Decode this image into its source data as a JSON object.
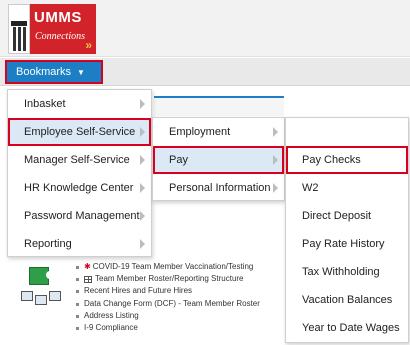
{
  "logo": {
    "title": "UMMS",
    "subtitle": "Connections",
    "chevron": "»"
  },
  "navbar": {
    "bookmarks_label": "Bookmarks",
    "caret": "▼"
  },
  "menu_level1": [
    {
      "label": "Inbasket"
    },
    {
      "label": "Employee Self-Service"
    },
    {
      "label": "Manager Self-Service"
    },
    {
      "label": "HR Knowledge Center"
    },
    {
      "label": "Password Management"
    },
    {
      "label": "Reporting"
    }
  ],
  "menu_level2": [
    {
      "label": "Employment"
    },
    {
      "label": "Pay"
    },
    {
      "label": "Personal Information"
    }
  ],
  "menu_level3": [
    {
      "label": "Pay Checks"
    },
    {
      "label": "W2"
    },
    {
      "label": "Direct Deposit"
    },
    {
      "label": "Pay Rate History"
    },
    {
      "label": "Tax Withholding"
    },
    {
      "label": "Vacation Balances"
    },
    {
      "label": "Year to Date Wages"
    }
  ],
  "links": [
    {
      "label": "COVID-19 Team Member Vaccination/Testing"
    },
    {
      "label": "Team Member Roster/Reporting Structure"
    },
    {
      "label": "Recent Hires and Future Hires"
    },
    {
      "label": "Data Change Form (DCF) - Team Member Roster"
    },
    {
      "label": "Address Listing"
    },
    {
      "label": "I-9 Compliance"
    }
  ],
  "colors": {
    "accent": "#1c7fc6",
    "highlight_border": "#d8001c",
    "brand": "#d2232a"
  }
}
